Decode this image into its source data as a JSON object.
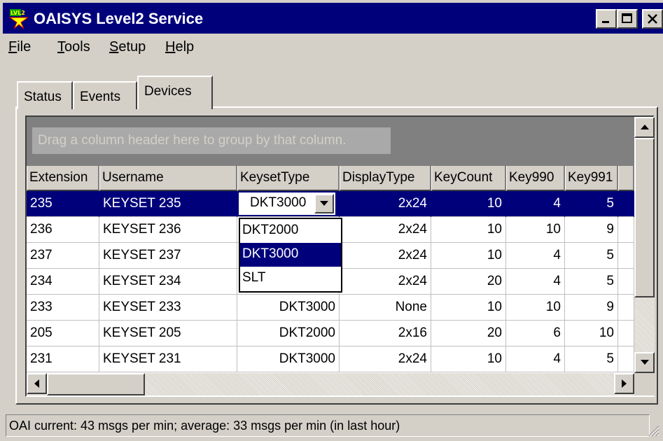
{
  "window": {
    "title": "OAISYS Level2 Service",
    "app_icon_text": "LVL2"
  },
  "menu": {
    "items": [
      {
        "label": "File",
        "mnemonic": "F",
        "rest": "ile"
      },
      {
        "label": "Tools",
        "mnemonic": "T",
        "rest": "ools"
      },
      {
        "label": "Setup",
        "mnemonic": "S",
        "rest": "etup"
      },
      {
        "label": "Help",
        "mnemonic": "H",
        "rest": "elp"
      }
    ]
  },
  "tabs": [
    {
      "label": "Status"
    },
    {
      "label": "Events"
    },
    {
      "label": "Devices",
      "active": true
    }
  ],
  "grid": {
    "group_hint": "Drag a column header here to group by that column.",
    "columns": [
      "Extension",
      "Username",
      "KeysetType",
      "DisplayType",
      "KeyCount",
      "Key990",
      "Key991",
      ""
    ],
    "rows": [
      {
        "extension": "235",
        "username": "KEYSET 235",
        "keyset_type": "DKT3000",
        "display_type": "2x24",
        "key_count": "10",
        "key990": "4",
        "key991": "5",
        "selected": true
      },
      {
        "extension": "236",
        "username": "KEYSET 236",
        "keyset_type": "",
        "display_type": "2x24",
        "key_count": "10",
        "key990": "10",
        "key991": "9"
      },
      {
        "extension": "237",
        "username": "KEYSET 237",
        "keyset_type": "",
        "display_type": "2x24",
        "key_count": "10",
        "key990": "4",
        "key991": "5"
      },
      {
        "extension": "234",
        "username": "KEYSET 234",
        "keyset_type": "",
        "display_type": "2x24",
        "key_count": "20",
        "key990": "4",
        "key991": "5"
      },
      {
        "extension": "233",
        "username": "KEYSET 233",
        "keyset_type": "DKT3000",
        "display_type": "None",
        "key_count": "10",
        "key990": "10",
        "key991": "9"
      },
      {
        "extension": "205",
        "username": "KEYSET 205",
        "keyset_type": "DKT2000",
        "display_type": "2x16",
        "key_count": "20",
        "key990": "6",
        "key991": "10"
      },
      {
        "extension": "231",
        "username": "KEYSET 231",
        "keyset_type": "DKT3000",
        "display_type": "2x24",
        "key_count": "10",
        "key990": "4",
        "key991": "5"
      }
    ],
    "editor": {
      "value": "DKT3000"
    },
    "dropdown_options": [
      "DKT2000",
      "DKT3000",
      "SLT"
    ],
    "dropdown_selected": "DKT3000"
  },
  "status_bar": {
    "text": "OAI current: 43 msgs per min; average: 33 msgs per min (in last hour)"
  },
  "colors": {
    "title_bar": "#00007b",
    "selection": "#00007b",
    "face": "#d4d0c8"
  }
}
